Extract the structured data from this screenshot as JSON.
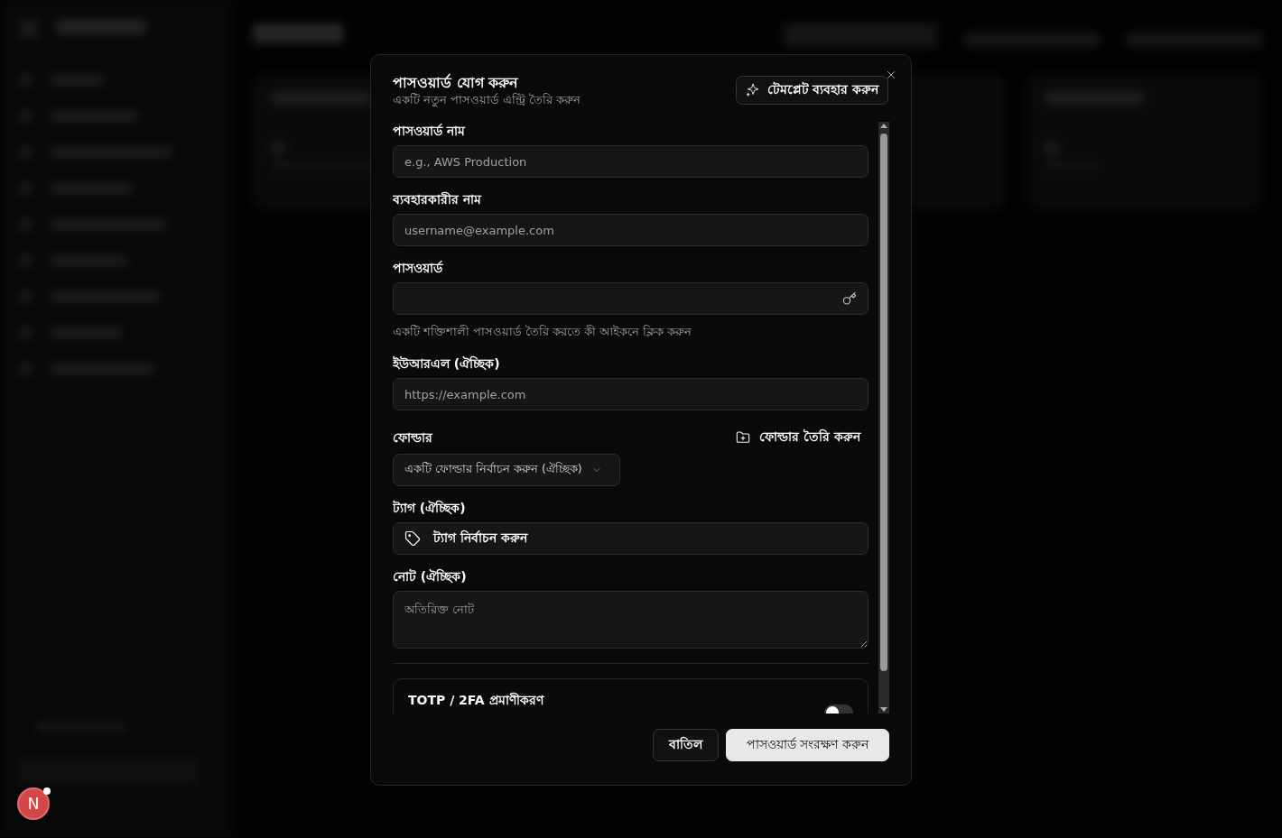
{
  "dialog": {
    "title": "পাসওয়ার্ড যোগ করুন",
    "subtitle": "একটি নতুন পাসওয়ার্ড এন্ট্রি তৈরি করুন",
    "template_button": "টেমপ্লেট ব্যবহার করুন",
    "fields": [
      {
        "kind": "input",
        "label": "পাসওয়ার্ড নাম",
        "placeholder": "e.g., AWS Production"
      },
      {
        "kind": "input",
        "label": "ব্যবহারকারীর নাম",
        "placeholder": "username@example.com"
      },
      {
        "kind": "password",
        "label": "পাসওয়ার্ড",
        "hint": "একটি শক্তিশালী পাসওয়ার্ড তৈরি করতে কী আইকনে ক্লিক করুন"
      },
      {
        "kind": "input",
        "label": "ইউআরএল (ঐচ্ছিক)",
        "placeholder": "https://example.com"
      },
      {
        "kind": "select",
        "label": "ফোল্ডার",
        "action": "ফোল্ডার তৈরি করুন",
        "text": "একটি ফোল্ডার নির্বাচন করুন (ঐচ্ছিক)"
      },
      {
        "kind": "tags",
        "label": "ট্যাগ (ঐচ্ছিক)",
        "text": "ট্যাগ নির্বাচন করুন"
      },
      {
        "kind": "textarea",
        "label": "নোট (ঐচ্ছিক)",
        "placeholder": "অতিরিক্ত নোট"
      }
    ],
    "totp": {
      "title": "TOTP / 2FA প্রমাণীকরণ",
      "on": false
    },
    "buttons": [
      {
        "kind": "secondary",
        "label": "বাতিল"
      },
      {
        "kind": "primary",
        "label": "পাসওয়ার্ড সংরক্ষণ করুন"
      }
    ]
  },
  "dev_badge": {
    "label": "N"
  }
}
